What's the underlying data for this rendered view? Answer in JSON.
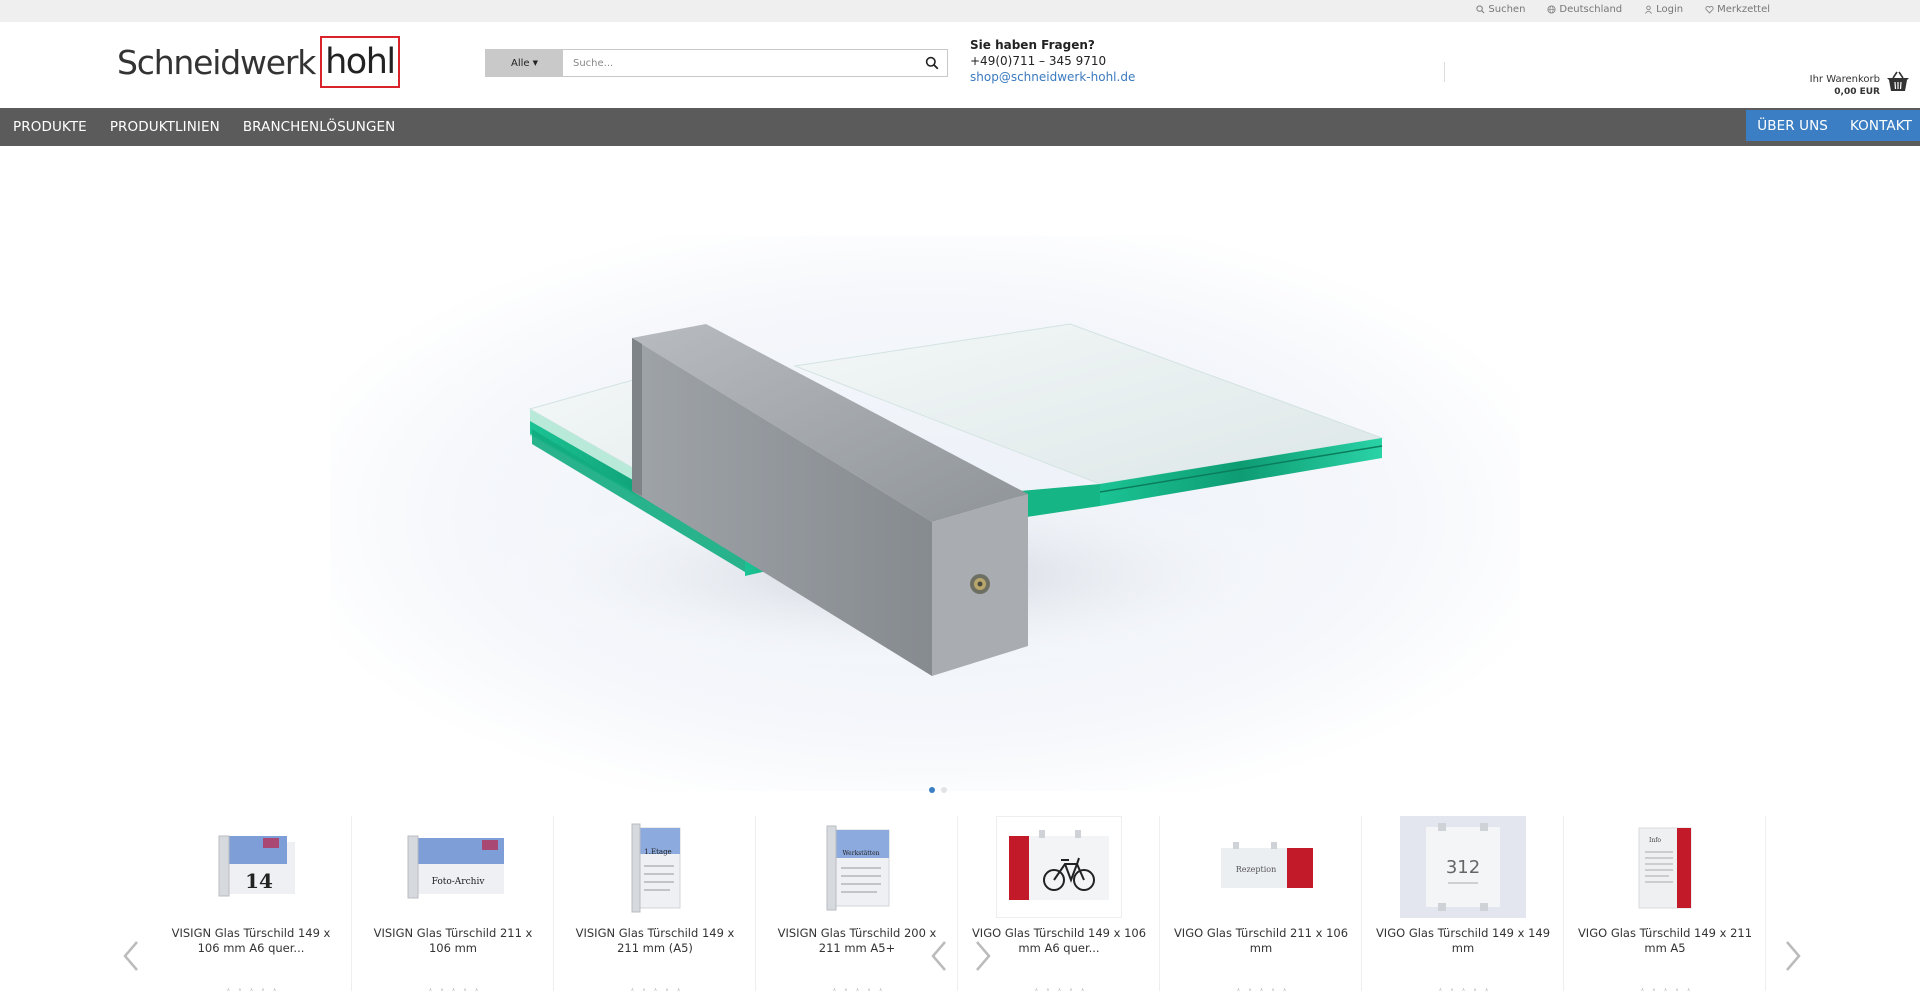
{
  "topbar": {
    "links": [
      {
        "label": "Suchen",
        "icon": "search-icon"
      },
      {
        "label": "Deutschland",
        "icon": "globe-icon"
      },
      {
        "label": "Login",
        "icon": "user-icon"
      },
      {
        "label": "Merkzettel",
        "icon": "heart-icon"
      }
    ]
  },
  "header": {
    "logo_part1": "Schneidwerk",
    "logo_part2": "hohl",
    "search_category": "Alle",
    "search_placeholder": "Suche...",
    "contact_title": "Sie haben Fragen?",
    "contact_phone": "+49(0)711 – 345 9710",
    "contact_email": "shop@schneidwerk-hohl.de",
    "cart_label": "Ihr Warenkorb",
    "cart_amount": "0,00 EUR"
  },
  "nav": {
    "left": [
      "PRODUKTE",
      "PRODUKTLINIEN",
      "BRANCHENLÖSUNGEN"
    ],
    "right": [
      "ÜBER UNS",
      "KONTAKT"
    ]
  },
  "hero": {
    "slides": 2,
    "active_slide": 0
  },
  "colors": {
    "accent_blue": "#3b7ec3",
    "nav_grey": "#5b5b5b",
    "logo_red": "#d8232a",
    "glass_green": "#1fc79a"
  },
  "products": [
    {
      "name": "VISIGN Glas Türschild 149 x 106 mm A6 quer...",
      "sign_text": "14"
    },
    {
      "name": "VISIGN Glas Türschild 211 x 106 mm",
      "sign_text": "Foto-Archiv"
    },
    {
      "name": "VISIGN Glas Türschild 149 x 211 mm (A5)",
      "sign_text": "1.Etage"
    },
    {
      "name": "VISIGN Glas Türschild 200 x 211 mm A5+",
      "sign_text": "Werkstätten"
    },
    {
      "name": "VIGO Glas Türschild 149 x 106 mm A6 quer...",
      "sign_text": ""
    },
    {
      "name": "VIGO Glas Türschild 211 x 106 mm",
      "sign_text": "Rezeption"
    },
    {
      "name": "VIGO Glas Türschild 149 x 149 mm",
      "sign_text": "312"
    },
    {
      "name": "VIGO Glas Türschild 149 x 211 mm A5",
      "sign_text": "Info"
    }
  ],
  "rating_stars": "☆☆☆☆☆"
}
